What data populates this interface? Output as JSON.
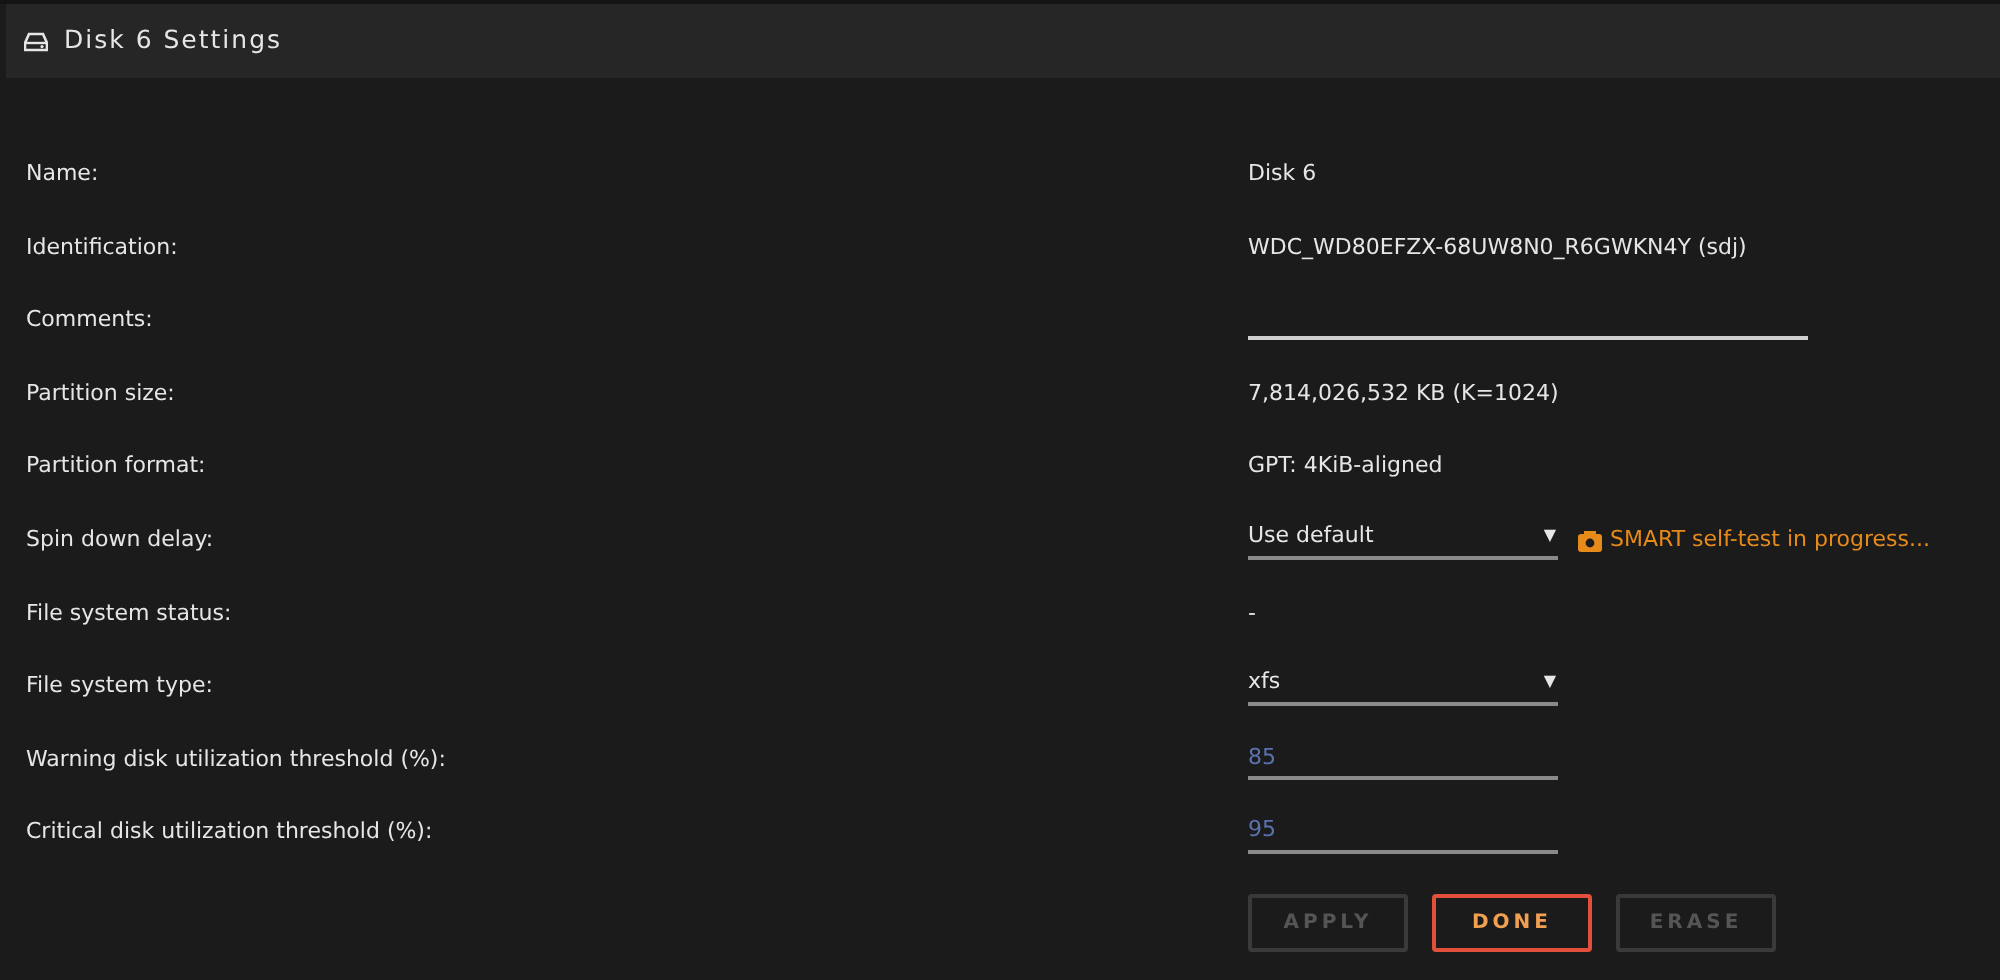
{
  "header": {
    "title": "Disk 6 Settings"
  },
  "rows": [
    {
      "label": "Name:",
      "kind": "text",
      "value": "Disk 6"
    },
    {
      "label": "Identification:",
      "kind": "text",
      "value": "WDC_WD80EFZX-68UW8N0_R6GWKN4Y (sdj)"
    },
    {
      "label": "Comments:",
      "kind": "input",
      "wide": true
    },
    {
      "label": "Partition size:",
      "kind": "text",
      "value": "7,814,026,532 KB (K=1024)"
    },
    {
      "label": "Partition format:",
      "kind": "text",
      "value": "GPT: 4KiB-aligned"
    },
    {
      "label": "Spin down delay:",
      "kind": "select",
      "value": "Use default",
      "arrow": "▼",
      "note": "SMART self-test in progress..."
    },
    {
      "label": "File system status:",
      "kind": "text",
      "value": "-"
    },
    {
      "label": "File system type:",
      "kind": "select",
      "value": "xfs",
      "arrow": "▼"
    },
    {
      "label": "Warning disk utilization threshold (%):",
      "kind": "input",
      "placeholder": "85"
    },
    {
      "label": "Critical disk utilization threshold (%):",
      "kind": "input",
      "placeholder": "95"
    }
  ],
  "buttons": [
    {
      "label": "APPLY",
      "disabled": true,
      "primary": false
    },
    {
      "label": "DONE",
      "disabled": false,
      "primary": true
    },
    {
      "label": "ERASE",
      "disabled": true,
      "primary": false
    }
  ]
}
